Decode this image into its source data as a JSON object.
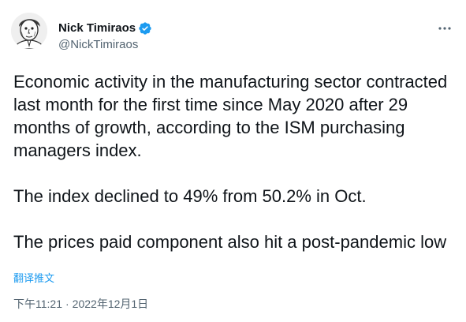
{
  "author": {
    "display_name": "Nick Timiraos",
    "handle": "@NickTimiraos",
    "verified": true,
    "avatar_icon": "avatar-sketch-portrait"
  },
  "menu": {
    "more_icon": "ellipsis-icon"
  },
  "tweet": {
    "paragraph_1": "Economic activity in the manufacturing sector contracted last month for the first time since May 2020 after 29 months of growth, according to the ISM purchasing managers index.",
    "paragraph_2": "The index declined to 49% from 50.2% in Oct.",
    "paragraph_3": "The prices paid component also hit a post-pandemic low"
  },
  "translate": {
    "label": "翻译推文"
  },
  "meta": {
    "time": "下午11:21",
    "separator": "·",
    "date": "2022年12月1日"
  },
  "colors": {
    "text": "#0f1419",
    "secondary": "#536471",
    "accent": "#1d9bf0"
  }
}
